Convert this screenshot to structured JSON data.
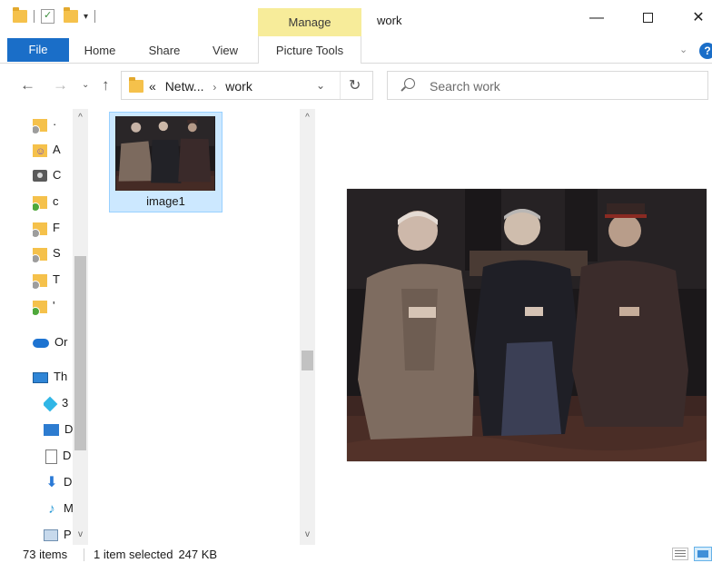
{
  "window": {
    "title": "work",
    "minimize_glyph": "—",
    "close_glyph": "✕"
  },
  "quick_access": {
    "dropdown_glyph": "▾"
  },
  "ribbon": {
    "contextual_group": "Manage",
    "tabs": [
      "File",
      "Home",
      "Share",
      "View",
      "Picture Tools"
    ],
    "expand_glyph": "⌄",
    "help_glyph": "?"
  },
  "address_bar": {
    "overflow_glyph": "«",
    "crumbs": [
      "Netw...",
      "work"
    ],
    "separator_glyph": "›",
    "dropdown_glyph": "⌄",
    "refresh_glyph": "↻"
  },
  "navigation_buttons": {
    "back_glyph": "←",
    "forward_glyph": "→",
    "recent_glyph": "⌄",
    "up_glyph": "↑"
  },
  "search": {
    "placeholder": "Search work"
  },
  "nav_pane": {
    "items": [
      {
        "label": "·",
        "icon": "folder-gray-icon"
      },
      {
        "label": "A",
        "icon": "people-folder-icon"
      },
      {
        "label": "C",
        "icon": "camera-icon"
      },
      {
        "label": "c",
        "icon": "folder-green-icon"
      },
      {
        "label": "F",
        "icon": "folder-gray-icon"
      },
      {
        "label": "S",
        "icon": "folder-gray-icon"
      },
      {
        "label": "T",
        "icon": "folder-gray-icon"
      },
      {
        "label": "'",
        "icon": "folder-green-icon"
      },
      {
        "label": "Or",
        "icon": "onedrive-cloud-icon"
      },
      {
        "label": "Th",
        "icon": "this-pc-icon"
      },
      {
        "label": "3",
        "icon": "3d-objects-icon"
      },
      {
        "label": "D",
        "icon": "desktop-icon"
      },
      {
        "label": "D",
        "icon": "documents-icon"
      },
      {
        "label": "D",
        "icon": "downloads-icon"
      },
      {
        "label": "M",
        "icon": "music-icon"
      },
      {
        "label": "P",
        "icon": "pictures-icon"
      }
    ],
    "scroll_up_glyph": "^",
    "scroll_down_glyph": "v"
  },
  "content": {
    "files": [
      {
        "name": "image1",
        "selected": true
      }
    ],
    "scroll_up_glyph": "^",
    "scroll_down_glyph": "v"
  },
  "status_bar": {
    "item_count": "73 items",
    "selection": "1 item selected",
    "size": "247 KB"
  },
  "colors": {
    "accent": "#1a6ec8",
    "manage_tab": "#f7ec9a",
    "selection_fill": "#cce8ff",
    "selection_border": "#99d1ff",
    "folder": "#f5c14b"
  }
}
